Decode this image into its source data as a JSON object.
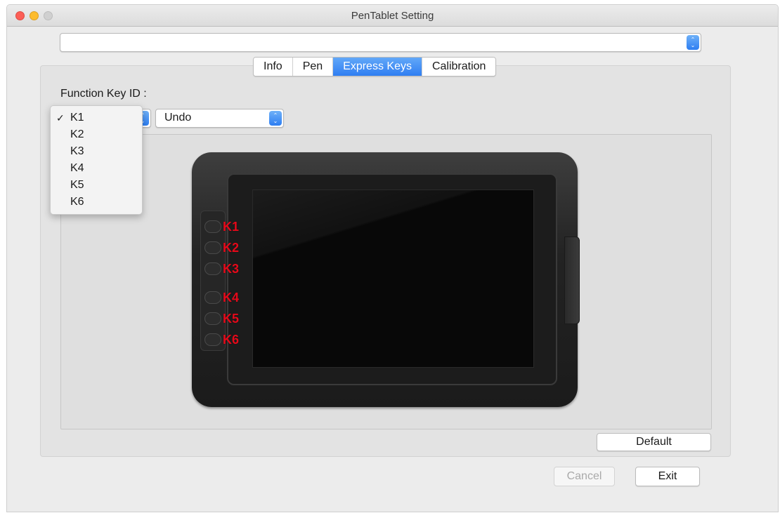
{
  "window": {
    "title": "PenTablet Setting"
  },
  "device_select": {
    "value": ""
  },
  "tabs": [
    {
      "label": "Info"
    },
    {
      "label": "Pen"
    },
    {
      "label": "Express Keys",
      "selected": true
    },
    {
      "label": "Calibration"
    }
  ],
  "express_keys": {
    "function_key_label": "Function Key ID :",
    "selected_key": "K1",
    "action_value": "Undo",
    "key_options": [
      "K1",
      "K2",
      "K3",
      "K4",
      "K5",
      "K6"
    ],
    "tablet_labels": [
      "K1",
      "K2",
      "K3",
      "K4",
      "K5",
      "K6"
    ]
  },
  "buttons": {
    "default": "Default",
    "cancel": "Cancel",
    "exit": "Exit"
  },
  "colors": {
    "accent": "#2f7ef2",
    "key_label": "#e5091a"
  },
  "icons": {
    "checkmark": "✓",
    "stepper": "stepper-arrows-icon"
  }
}
